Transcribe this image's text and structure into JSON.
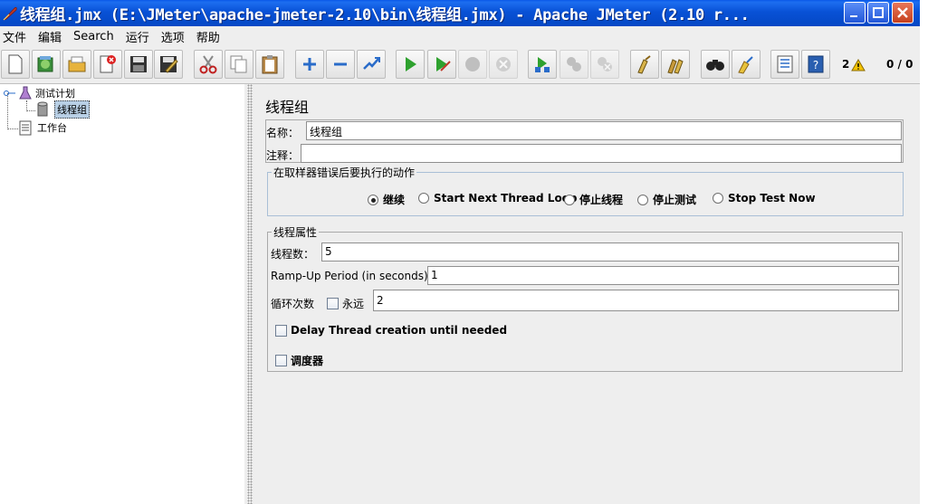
{
  "window": {
    "title": "线程组.jmx (E:\\JMeter\\apache-jmeter-2.10\\bin\\线程组.jmx) - Apache JMeter (2.10 r..."
  },
  "menu": [
    "文件",
    "编辑",
    "Search",
    "运行",
    "选项",
    "帮助"
  ],
  "toolbar": {
    "buttons": [
      "new-icon",
      "templates-icon",
      "open-icon",
      "close-icon",
      "save-icon",
      "save-as-icon",
      "cut-icon",
      "copy-icon",
      "paste-icon",
      "expand-icon",
      "collapse-icon",
      "toggle-icon",
      "start-icon",
      "start-no-pause-icon",
      "stop-icon",
      "shutdown-icon",
      "remote-start-icon",
      "remote-stop-icon",
      "remote-shutdown-icon",
      "clear-icon",
      "clear-all-icon",
      "search-icon",
      "reset-search-icon",
      "function-helper-icon",
      "help-icon"
    ],
    "warning_count": "2",
    "thread_status": "0 / 0"
  },
  "tree": {
    "test_plan": "测试计划",
    "thread_group": "线程组",
    "workbench": "工作台"
  },
  "thread_group": {
    "panel_title": "线程组",
    "name_label": "名称：",
    "name_value": "线程组",
    "comment_label": "注释：",
    "comment_value": "",
    "error_action": {
      "title": "在取样器错误后要执行的动作",
      "options": [
        "继续",
        "Start Next Thread Loop",
        "停止线程",
        "停止测试",
        "Stop Test Now"
      ],
      "selected": 0
    },
    "properties": {
      "title": "线程属性",
      "threads_label": "线程数：",
      "threads_value": "5",
      "rampup_label": "Ramp-Up Period (in seconds):",
      "rampup_value": "1",
      "loop_label": "循环次数",
      "forever_label": "永远",
      "forever_checked": false,
      "loop_value": "2",
      "delay_label": "Delay Thread creation until needed",
      "delay_checked": false,
      "scheduler_label": "调度器",
      "scheduler_checked": false
    }
  },
  "colors": {
    "titlebar": "#0548c4",
    "selected_node": "#b8cfe5"
  }
}
